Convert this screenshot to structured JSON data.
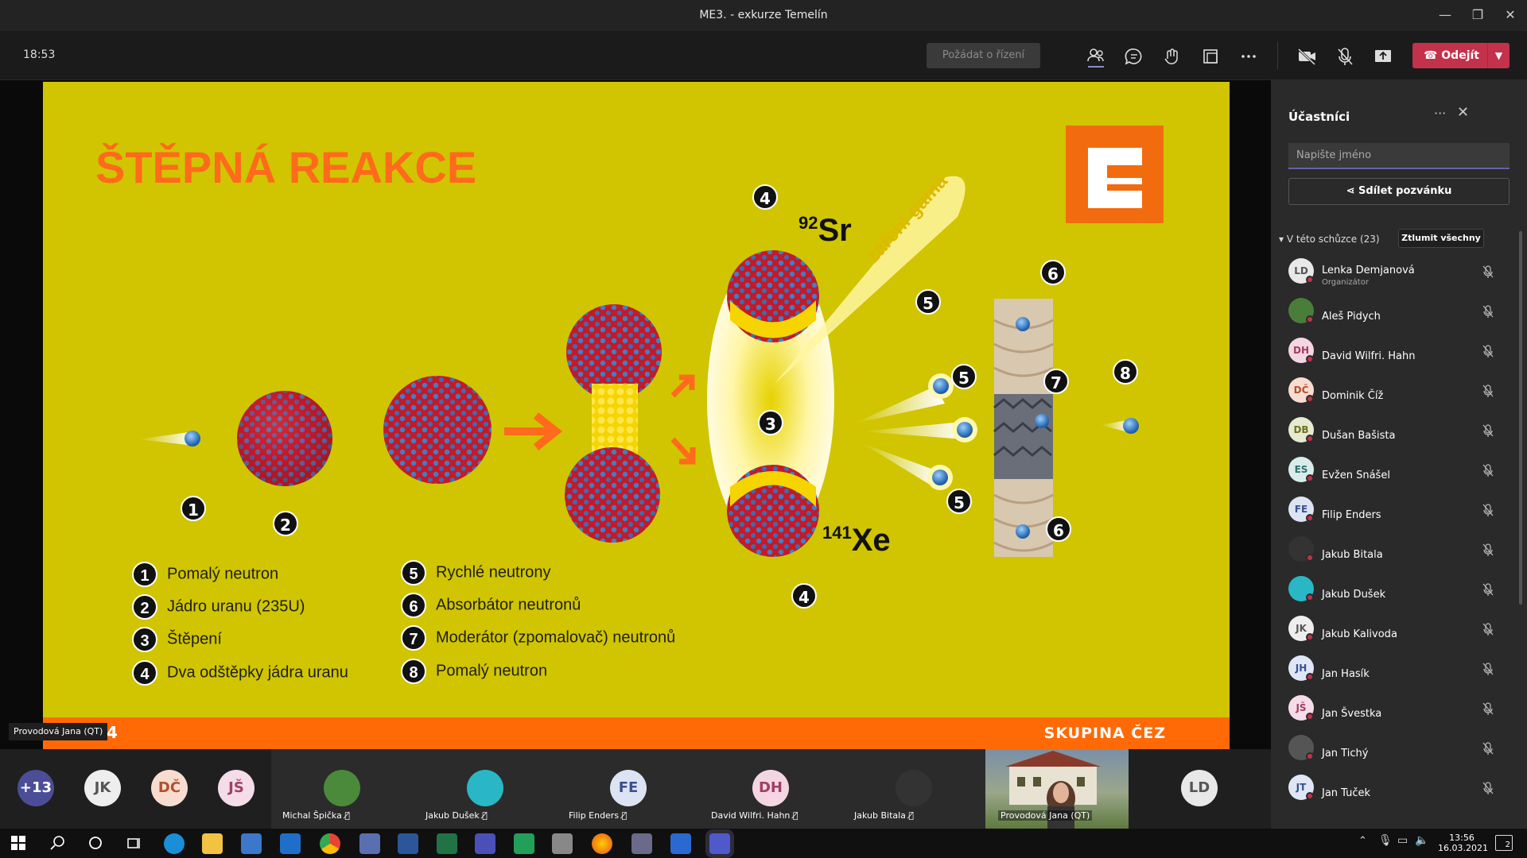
{
  "window": {
    "title": "ME3. - exkurze Temelín",
    "minimize": "—",
    "restore": "❐",
    "close": "✕"
  },
  "toolbar": {
    "clock": "18:53",
    "request_control": "Požádat o řízení",
    "leave_label": "Odejít",
    "icons": [
      "participants-icon",
      "chat-icon",
      "reactions-icon",
      "rooms-icon",
      "more-icon",
      "camera-off-icon",
      "mic-off-icon",
      "share-icon"
    ]
  },
  "slide": {
    "title": "ŠTĚPNÁ REAKCE",
    "footer_brand": "SKUPINA ČEZ",
    "page_number": "4",
    "presenter_label": "Provodová Jana (QT)",
    "isotope_sr": {
      "mass": "92",
      "symbol": "Sr"
    },
    "isotope_xe": {
      "mass": "141",
      "symbol": "Xe"
    },
    "gamma_label": "záření gama",
    "diagram_numbers": [
      "1",
      "2",
      "3",
      "4",
      "4",
      "5",
      "5",
      "5",
      "6",
      "6",
      "7",
      "8"
    ],
    "legend_left": [
      {
        "n": "1",
        "text": "Pomalý neutron"
      },
      {
        "n": "2",
        "text": "Jádro uranu (235U)"
      },
      {
        "n": "3",
        "text": "Štěpení"
      },
      {
        "n": "4",
        "text": "Dva odštěpky jádra uranu"
      }
    ],
    "legend_right": [
      {
        "n": "5",
        "text": "Rychlé neutrony"
      },
      {
        "n": "6",
        "text": "Absorbátor neutronů"
      },
      {
        "n": "7",
        "text": "Moderátor (zpomalovač) neutronů"
      },
      {
        "n": "8",
        "text": "Pomalý neutron"
      }
    ]
  },
  "panel": {
    "title": "Účastníci",
    "more": "···",
    "close": "✕",
    "search_placeholder": "Napište jméno",
    "share_invite": "Sdílet pozvánku",
    "section_label": "▾ V této schůzce (23)",
    "mute_all": "Ztlumit všechny",
    "participants": [
      {
        "initials": "LD",
        "name": "Lenka Demjanová",
        "role": "Organizátor",
        "color": "#e8e8e8",
        "fg": "#555"
      },
      {
        "initials": "",
        "name": "Aleš Pidych",
        "role": "",
        "color": "#4a7d3a",
        "fg": "#fff"
      },
      {
        "initials": "DH",
        "name": "David Wilfri. Hahn",
        "role": "",
        "color": "#f4d6e2",
        "fg": "#a04060"
      },
      {
        "initials": "DČ",
        "name": "Dominik Číž",
        "role": "",
        "color": "#f8dcd0",
        "fg": "#b05030"
      },
      {
        "initials": "DB",
        "name": "Dušan Bašista",
        "role": "",
        "color": "#e6ead0",
        "fg": "#707020"
      },
      {
        "initials": "ES",
        "name": "Evžen Snášel",
        "role": "",
        "color": "#d8ecec",
        "fg": "#307070"
      },
      {
        "initials": "FE",
        "name": "Filip Enders",
        "role": "",
        "color": "#dce4f4",
        "fg": "#3a5090"
      },
      {
        "initials": "",
        "name": "Jakub Bitala",
        "role": "",
        "color": "#333",
        "fg": "#fff"
      },
      {
        "initials": "",
        "name": "Jakub Dušek",
        "role": "",
        "color": "#2ab7c5",
        "fg": "#fff"
      },
      {
        "initials": "JK",
        "name": "Jakub Kalivoda",
        "role": "",
        "color": "#eee",
        "fg": "#555"
      },
      {
        "initials": "JH",
        "name": "Jan Hasík",
        "role": "",
        "color": "#dfe6f6",
        "fg": "#3a5090"
      },
      {
        "initials": "JŠ",
        "name": "Jan Švestka",
        "role": "",
        "color": "#f4dce8",
        "fg": "#a04060"
      },
      {
        "initials": "",
        "name": "Jan Tichý",
        "role": "",
        "color": "#555",
        "fg": "#fff"
      },
      {
        "initials": "JT",
        "name": "Jan Tuček",
        "role": "",
        "color": "#dfe6f6",
        "fg": "#3a5090"
      }
    ]
  },
  "strip": {
    "overflow": "+13",
    "avatars": [
      {
        "initials": "JK",
        "color": "#eee",
        "fg": "#555"
      },
      {
        "initials": "DČ",
        "color": "#f8dcd0",
        "fg": "#b05030"
      },
      {
        "initials": "JŠ",
        "color": "#f4dce8",
        "fg": "#a04060"
      }
    ],
    "tiles": [
      {
        "initials": "",
        "name": "Michal Špička",
        "color": "#4a8a3a",
        "fg": "#fff"
      },
      {
        "initials": "",
        "name": "Jakub Dušek",
        "color": "#2ab7c5",
        "fg": "#fff"
      },
      {
        "initials": "FE",
        "name": "Filip Enders",
        "color": "#dce4f4",
        "fg": "#3a5090"
      },
      {
        "initials": "DH",
        "name": "David Wilfri. Hahn",
        "color": "#f4d6e2",
        "fg": "#a04060"
      },
      {
        "initials": "",
        "name": "Jakub Bitala",
        "color": "#333",
        "fg": "#fff"
      }
    ],
    "video_name": "Provodová Jana (QT)",
    "last_avatar": {
      "initials": "LD",
      "color": "#e8e8e8",
      "fg": "#555"
    }
  },
  "taskbar": {
    "time": "13:56",
    "date": "16.03.2021",
    "notifications": "2"
  }
}
